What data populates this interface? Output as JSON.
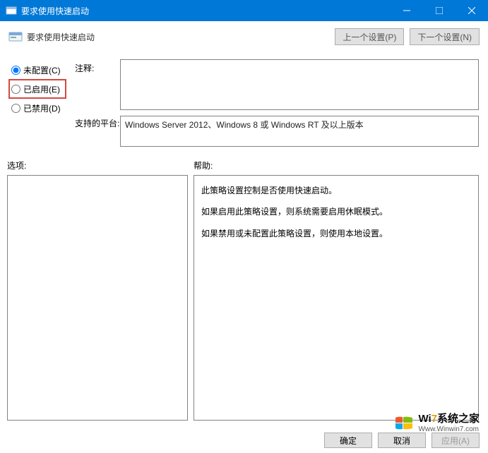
{
  "titlebar": {
    "title": "要求使用快速启动"
  },
  "header": {
    "title": "要求使用快速启动",
    "prev_btn": "上一个设置(P)",
    "next_btn": "下一个设置(N)"
  },
  "radios": {
    "not_configured": "未配置(C)",
    "enabled": "已启用(E)",
    "disabled": "已禁用(D)",
    "selected": "not_configured"
  },
  "labels": {
    "comment": "注释:",
    "platform": "支持的平台:",
    "options": "选项:",
    "help": "帮助:"
  },
  "comment_text": "",
  "platform_text": "Windows Server 2012、Windows 8 或 Windows RT 及以上版本",
  "help_lines": [
    "此策略设置控制是否使用快速启动。",
    "如果启用此策略设置，则系统需要启用休眠模式。",
    "如果禁用或未配置此策略设置，则使用本地设置。"
  ],
  "footer": {
    "ok": "确定",
    "cancel": "取消",
    "apply": "应用(A)"
  },
  "watermark": {
    "brand_prefix": "Wi",
    "brand_accent": "7",
    "brand_suffix": "系统之家",
    "url": "Www.Winwin7.com"
  }
}
